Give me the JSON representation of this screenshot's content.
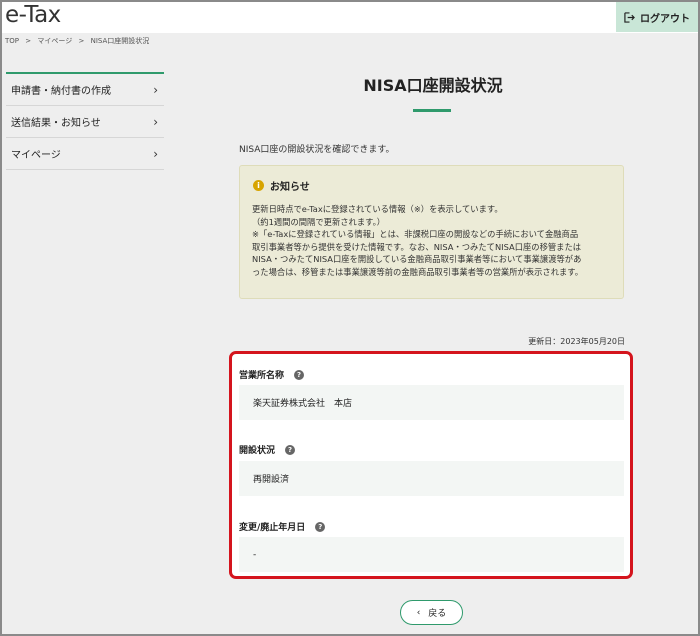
{
  "header": {
    "logo": "e-Tax",
    "logout_label": "ログアウト"
  },
  "breadcrumb": [
    "TOP",
    ">",
    "マイページ",
    ">",
    "NISA口座開設状況"
  ],
  "sidebar": {
    "items": [
      {
        "label": "申請書・納付書の作成"
      },
      {
        "label": "送信結果・お知らせ"
      },
      {
        "label": "マイページ"
      }
    ]
  },
  "main": {
    "title": "NISA口座開設状況",
    "intro": "NISA口座の開設状況を確認できます。",
    "notice": {
      "heading": "お知らせ",
      "lines": [
        "更新日時点でe-Taxに登録されている情報（※）を表示しています。",
        "（約1週間の間隔で更新されます。）",
        "※「e-Taxに登録されている情報」とは、非課税口座の開設などの手続において金融商品",
        "取引事業者等から提供を受けた情報です。なお、NISA・つみたてNISA口座の移管または",
        "NISA・つみたてNISA口座を開設している金融商品取引事業者等において事業譲渡等があ",
        "った場合は、移管または事業譲渡等前の金融商品取引事業者等の営業所が表示されます。"
      ]
    },
    "updated": "更新日：2023年05月20日",
    "fields": [
      {
        "label": "営業所名称",
        "value": "楽天証券株式会社　本店"
      },
      {
        "label": "開設状況",
        "value": "再開設済"
      },
      {
        "label": "変更/廃止年月日",
        "value": "-"
      }
    ],
    "back_label": "戻る"
  },
  "colors": {
    "accent": "#2f9a6c",
    "highlight_border": "#d4141d",
    "notice_bg": "#ecebd7"
  }
}
